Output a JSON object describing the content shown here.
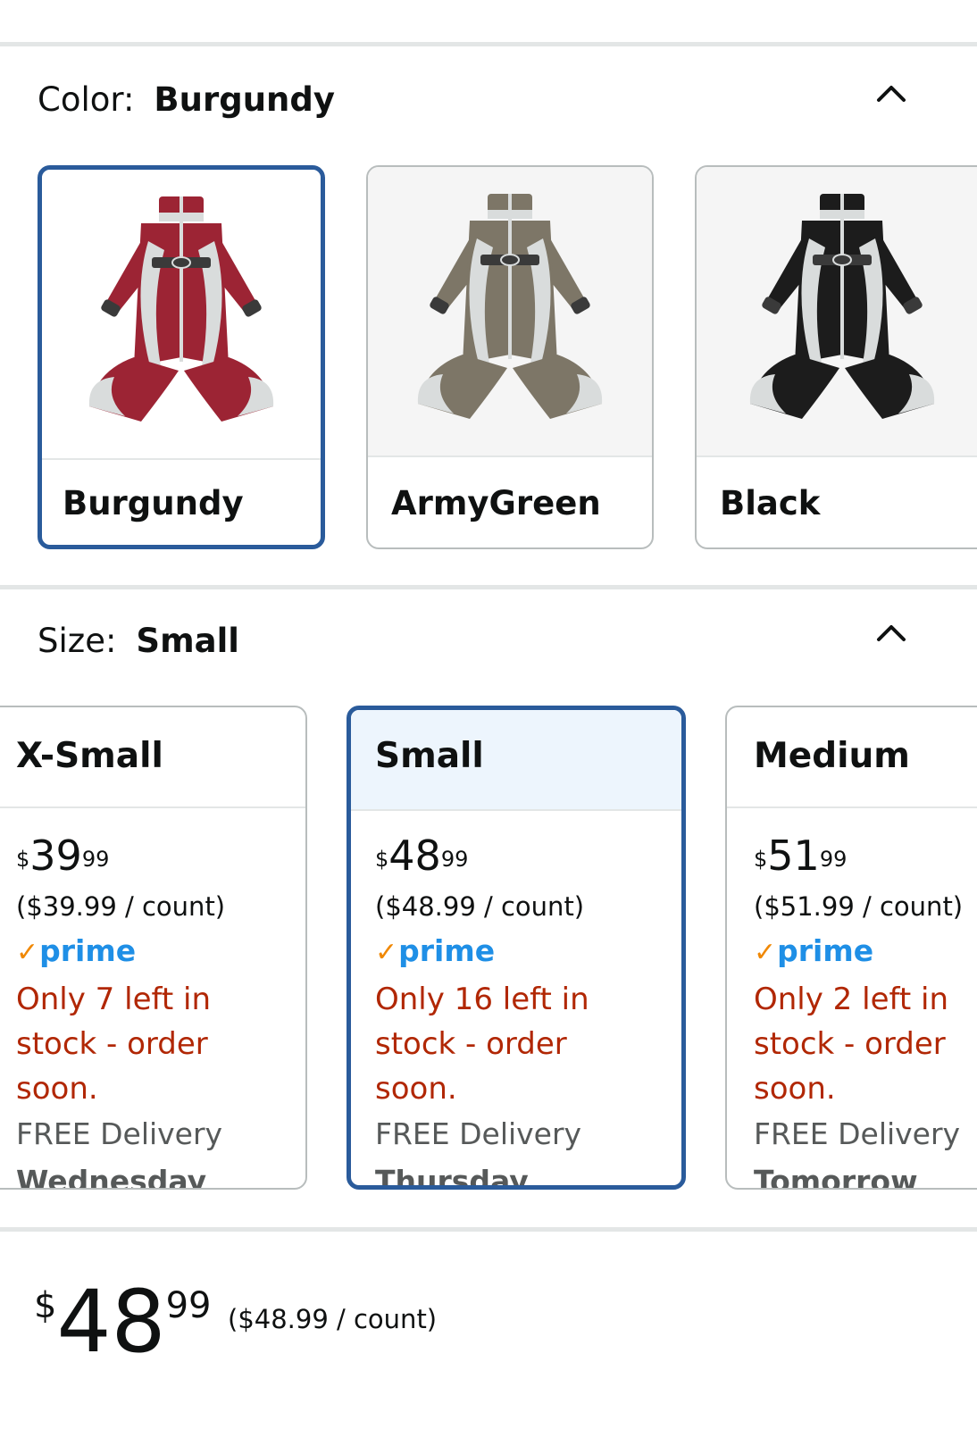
{
  "color_section": {
    "label": "Color:",
    "value": "Burgundy",
    "collapse_icon": "chevron-up-icon",
    "swatches": [
      {
        "name": "Burgundy",
        "body_color": "#9c2434",
        "selected": true
      },
      {
        "name": "ArmyGreen",
        "body_color": "#7d7667",
        "selected": false
      },
      {
        "name": "Black",
        "body_color": "#1c1c1c",
        "selected": false
      }
    ]
  },
  "size_section": {
    "label": "Size:",
    "value": "Small",
    "collapse_icon": "chevron-up-icon",
    "options": [
      {
        "name": "X-Small",
        "currency": "$",
        "whole": "39",
        "fraction": "99",
        "unit_price": "($39.99 / count)",
        "prime": "prime",
        "stock": "Only 7 left in stock - order soon.",
        "delivery": "FREE Delivery",
        "day": "Wednesday",
        "selected": false
      },
      {
        "name": "Small",
        "currency": "$",
        "whole": "48",
        "fraction": "99",
        "unit_price": "($48.99 / count)",
        "prime": "prime",
        "stock": "Only 16 left in stock - order soon.",
        "delivery": "FREE Delivery",
        "day": "Thursday",
        "selected": true
      },
      {
        "name": "Medium",
        "currency": "$",
        "whole": "51",
        "fraction": "99",
        "unit_price": "($51.99 / count)",
        "prime": "prime",
        "stock": "Only 2 left in stock - order soon.",
        "delivery": "FREE Delivery",
        "day": "Tomorrow",
        "selected": false
      }
    ]
  },
  "summary": {
    "currency": "$",
    "whole": "48",
    "fraction": "99",
    "unit_price": "($48.99 / count)"
  },
  "colors": {
    "selected_border": "#2a5b9b",
    "stock_red": "#b12704",
    "prime_blue": "#1f8fe6",
    "prime_check": "#f08804"
  }
}
